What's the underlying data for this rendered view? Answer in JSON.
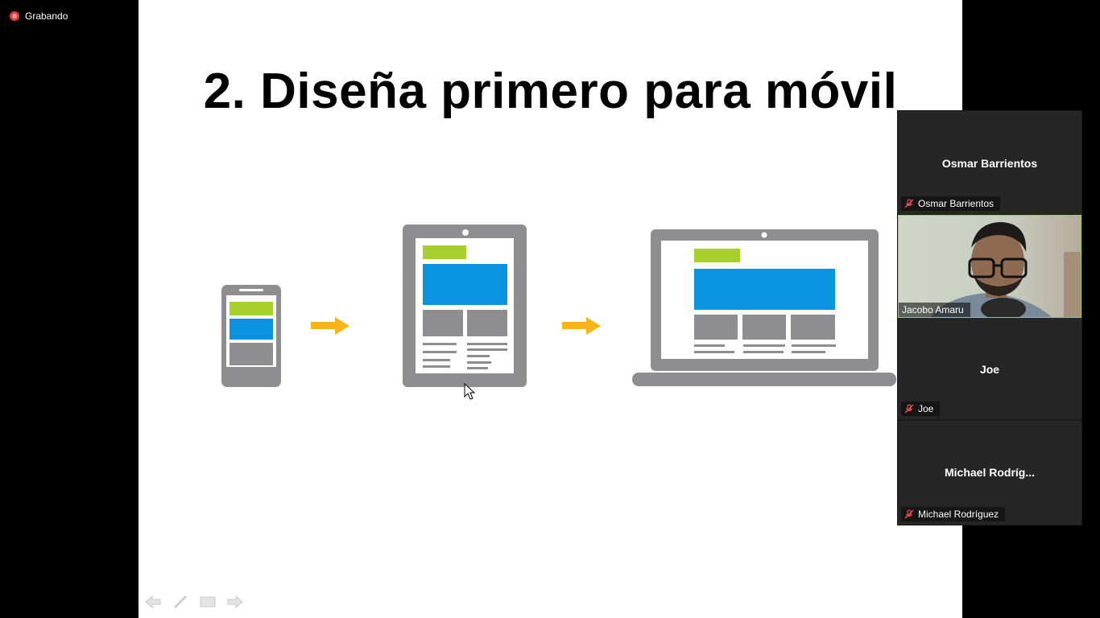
{
  "recording": {
    "label": "Grabando"
  },
  "slide": {
    "title": "2. Diseña primero para móvil"
  },
  "participants": [
    {
      "display_name": "Osmar Barrientos",
      "label": "Osmar Barrientos",
      "muted": true
    },
    {
      "display_name": "",
      "label": "Jacobo Amaru",
      "video": true
    },
    {
      "display_name": "Joe",
      "label": "Joe",
      "muted": true
    },
    {
      "display_name": "Michael  Rodríg...",
      "label": "Michael Rodríguez",
      "muted": true
    }
  ],
  "colors": {
    "green": "#a7d02c",
    "blue": "#0a93e0",
    "gray": "#8e8e90",
    "arrow": "#f7b519",
    "active_speaker_border": "#9ad43b"
  },
  "icons": [
    "recording-icon",
    "mic-muted-icon",
    "prev-arrow-icon",
    "pen-icon",
    "screen-icon",
    "next-arrow-icon"
  ]
}
